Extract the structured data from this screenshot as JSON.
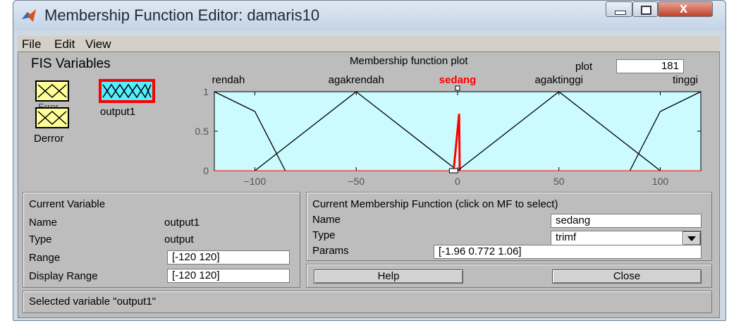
{
  "window": {
    "title": "Membership Function Editor: damaris10"
  },
  "menu": [
    "File",
    "Edit",
    "View"
  ],
  "fis_variables": {
    "heading": "FIS Variables",
    "inputs": [
      "Error",
      "Derror"
    ],
    "output_label": "output1"
  },
  "plot": {
    "title": "Membership function plot",
    "points_label": "plot",
    "points_value": "181",
    "mf_labels": [
      "rendah",
      "agakrendah",
      "sedang",
      "agaktinggi",
      "tinggi"
    ],
    "selected_mf": "sedang",
    "colors": {
      "background": "#cbfbff",
      "lines": "#000000",
      "selected": "#ff0000"
    }
  },
  "chart_data": {
    "type": "line",
    "xlim": [
      -120,
      120
    ],
    "ylim": [
      0,
      1
    ],
    "x_ticks": [
      "-100",
      "-50",
      "0",
      "50",
      "100"
    ],
    "y_ticks": [
      "0",
      "0.5",
      "1"
    ],
    "series": [
      {
        "name": "rendah",
        "points": [
          [
            -120,
            1
          ],
          [
            -100,
            0.75
          ],
          [
            -85,
            0
          ]
        ]
      },
      {
        "name": "agakrendah",
        "points": [
          [
            -100,
            0
          ],
          [
            -50,
            1
          ],
          [
            0,
            0
          ]
        ]
      },
      {
        "name": "sedang",
        "points": [
          [
            -1.96,
            0
          ],
          [
            0.772,
            0.72
          ],
          [
            1.06,
            0
          ]
        ]
      },
      {
        "name": "agaktinggi",
        "points": [
          [
            0,
            0
          ],
          [
            50,
            1
          ],
          [
            100,
            0
          ]
        ]
      },
      {
        "name": "tinggi",
        "points": [
          [
            85,
            0
          ],
          [
            100,
            0.75
          ],
          [
            120,
            1
          ]
        ]
      }
    ]
  },
  "current_variable": {
    "heading": "Current Variable",
    "rows": [
      {
        "label": "Name",
        "value": "output1"
      },
      {
        "label": "Type",
        "value": "output"
      },
      {
        "label": "Range",
        "value": "[-120 120]"
      },
      {
        "label": "Display Range",
        "value": "[-120 120]"
      }
    ]
  },
  "current_mf": {
    "heading": "Current Membership Function (click on MF to select)",
    "name_label": "Name",
    "name_value": "sedang",
    "type_label": "Type",
    "type_value": "trimf",
    "params_label": "Params",
    "params_value": "[-1.96 0.772 1.06]"
  },
  "buttons": {
    "help": "Help",
    "close": "Close"
  },
  "status": "Selected variable \"output1\""
}
